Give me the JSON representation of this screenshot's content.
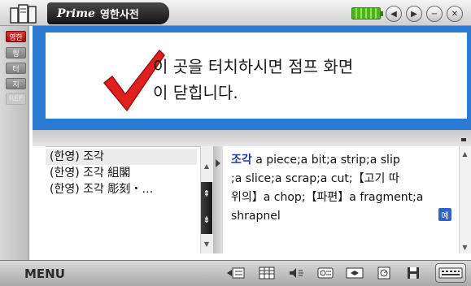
{
  "app": {
    "brand": "Prime",
    "title": "영한사전"
  },
  "window_buttons": [
    {
      "name": "back-icon",
      "glyph": "◀"
    },
    {
      "name": "forward-icon",
      "glyph": "▶"
    },
    {
      "name": "minimize-icon",
      "glyph": "−"
    },
    {
      "name": "close-icon",
      "glyph": "✕"
    }
  ],
  "sidebar": {
    "tabs": [
      {
        "label": "영한",
        "state": "active"
      },
      {
        "label": "뭥",
        "state": "normal"
      },
      {
        "label": "터",
        "state": "normal"
      },
      {
        "label": "지",
        "state": "normal"
      },
      {
        "label": "REF",
        "state": "dim"
      }
    ]
  },
  "popup": {
    "message_line1": "이 곳을 터치하시면 점프 화면",
    "message_line2": "이 닫힙니다.",
    "check_color": "#e01f1f",
    "border_color": "#2b7bd2"
  },
  "wordlist": {
    "items": [
      "(한영) 조각",
      "(한영) 조각 組閣",
      "(한영) 조각 彫刻・…"
    ],
    "selected_index": 0
  },
  "definition": {
    "headword": "조각",
    "line1_rest": " a piece;a bit;a strip;a slip",
    "line2": ";a slice;a scrap;a cut;【고기 따",
    "line3": "위의】a chop;【파편】a fragment;a",
    "line4": " shrapnel",
    "example_badge": "예"
  },
  "toolbar": {
    "menu_label": "MENU",
    "tools": [
      "send-icon",
      "grid-icon",
      "pronounce-icon",
      "word-icon",
      "swap-icon",
      "memo-icon",
      "save-icon",
      "keyboard-icon"
    ]
  }
}
